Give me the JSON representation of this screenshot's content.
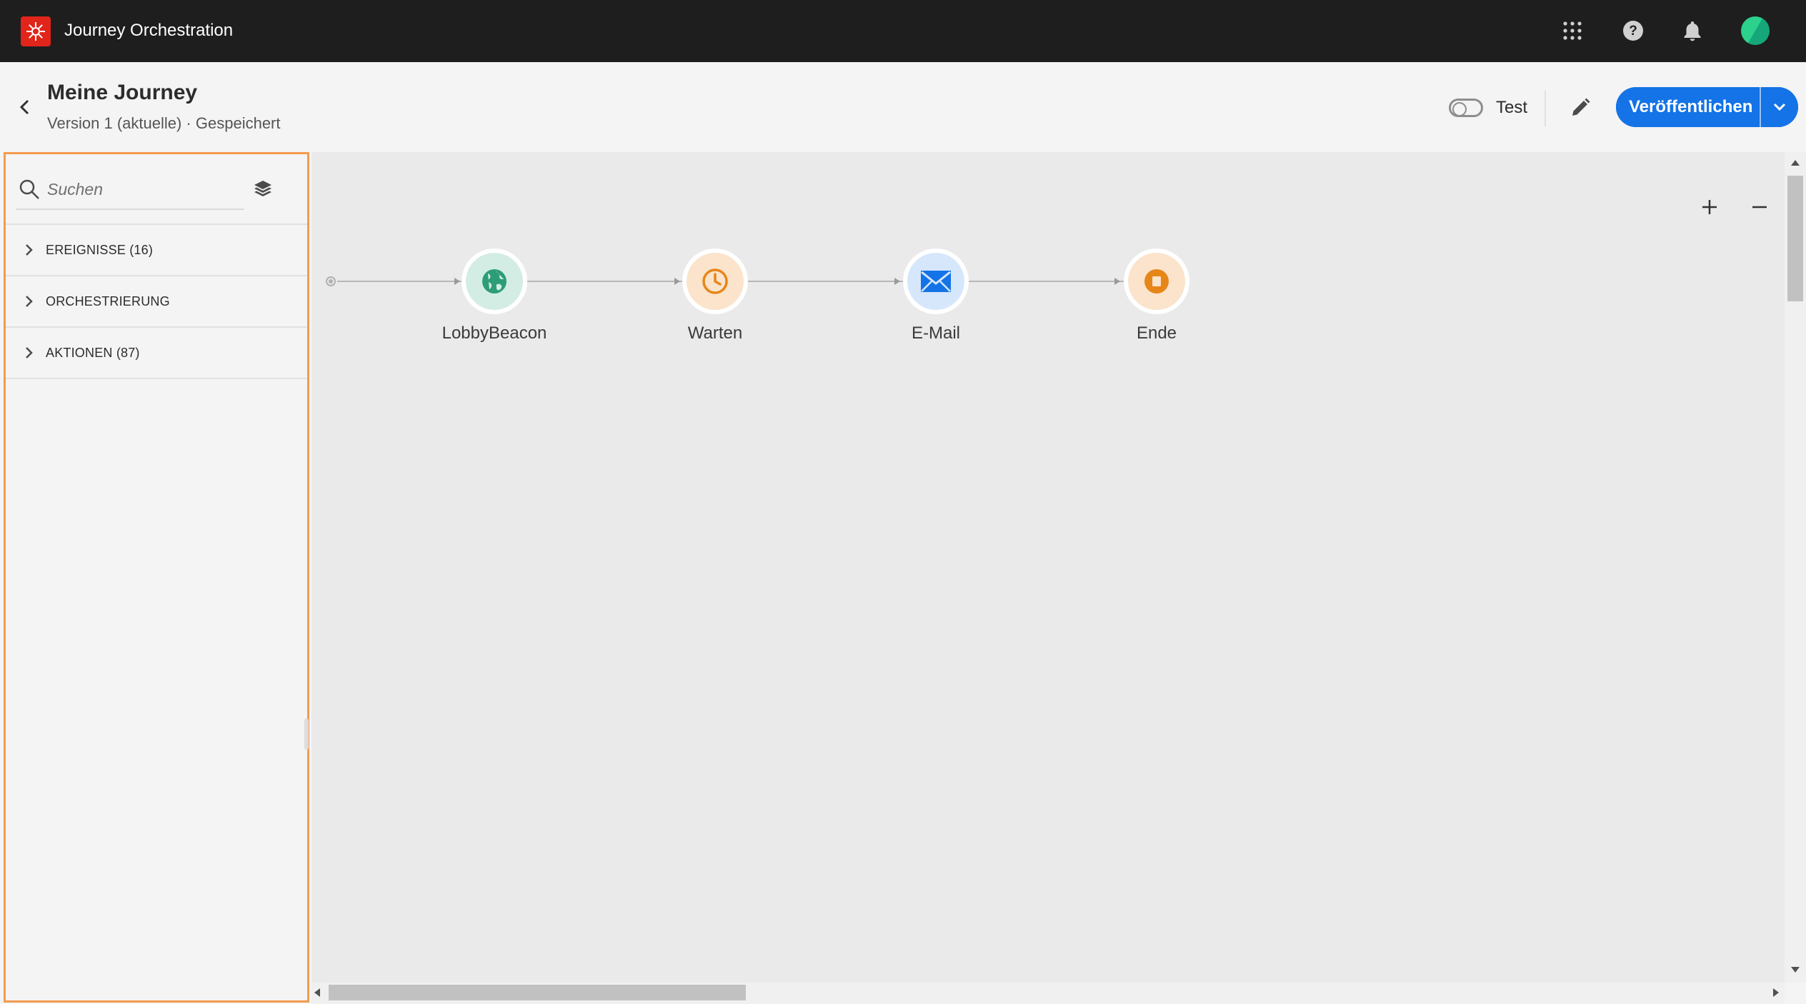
{
  "topbar": {
    "app_title": "Journey Orchestration",
    "logo_icon": "adobe-logo-icon",
    "icons": [
      "apps-grid-icon",
      "help-icon",
      "notifications-bell-icon",
      "user-avatar"
    ]
  },
  "header": {
    "title": "Meine Journey",
    "subtitle": "Version 1 (aktuelle) · Gespeichert",
    "test_toggle_label": "Test",
    "test_toggle_on": false,
    "publish_label": "Veröffentlichen"
  },
  "sidebar": {
    "search_placeholder": "Suchen",
    "categories": [
      {
        "label": "EREIGNISSE (16)"
      },
      {
        "label": "ORCHESTRIERUNG"
      },
      {
        "label": "AKTIONEN (87)"
      }
    ]
  },
  "canvas": {
    "nodes": [
      {
        "label": "LobbyBeacon",
        "icon": "globe-icon",
        "color": "#2d9d78",
        "bg": "#d4ede4"
      },
      {
        "label": "Warten",
        "icon": "clock-icon",
        "color": "#e68619",
        "bg": "#fbe3cc"
      },
      {
        "label": "E-Mail",
        "icon": "email-icon",
        "color": "#1473e6",
        "bg": "#d6e7fc"
      },
      {
        "label": "Ende",
        "icon": "stop-icon",
        "color": "#e68619",
        "bg": "#fbe3cc"
      }
    ]
  },
  "colors": {
    "accent": "#1473e6",
    "topbar_bg": "#1e1e1e",
    "panel_highlight": "#f39b4e",
    "adobe_red": "#e1251b"
  }
}
